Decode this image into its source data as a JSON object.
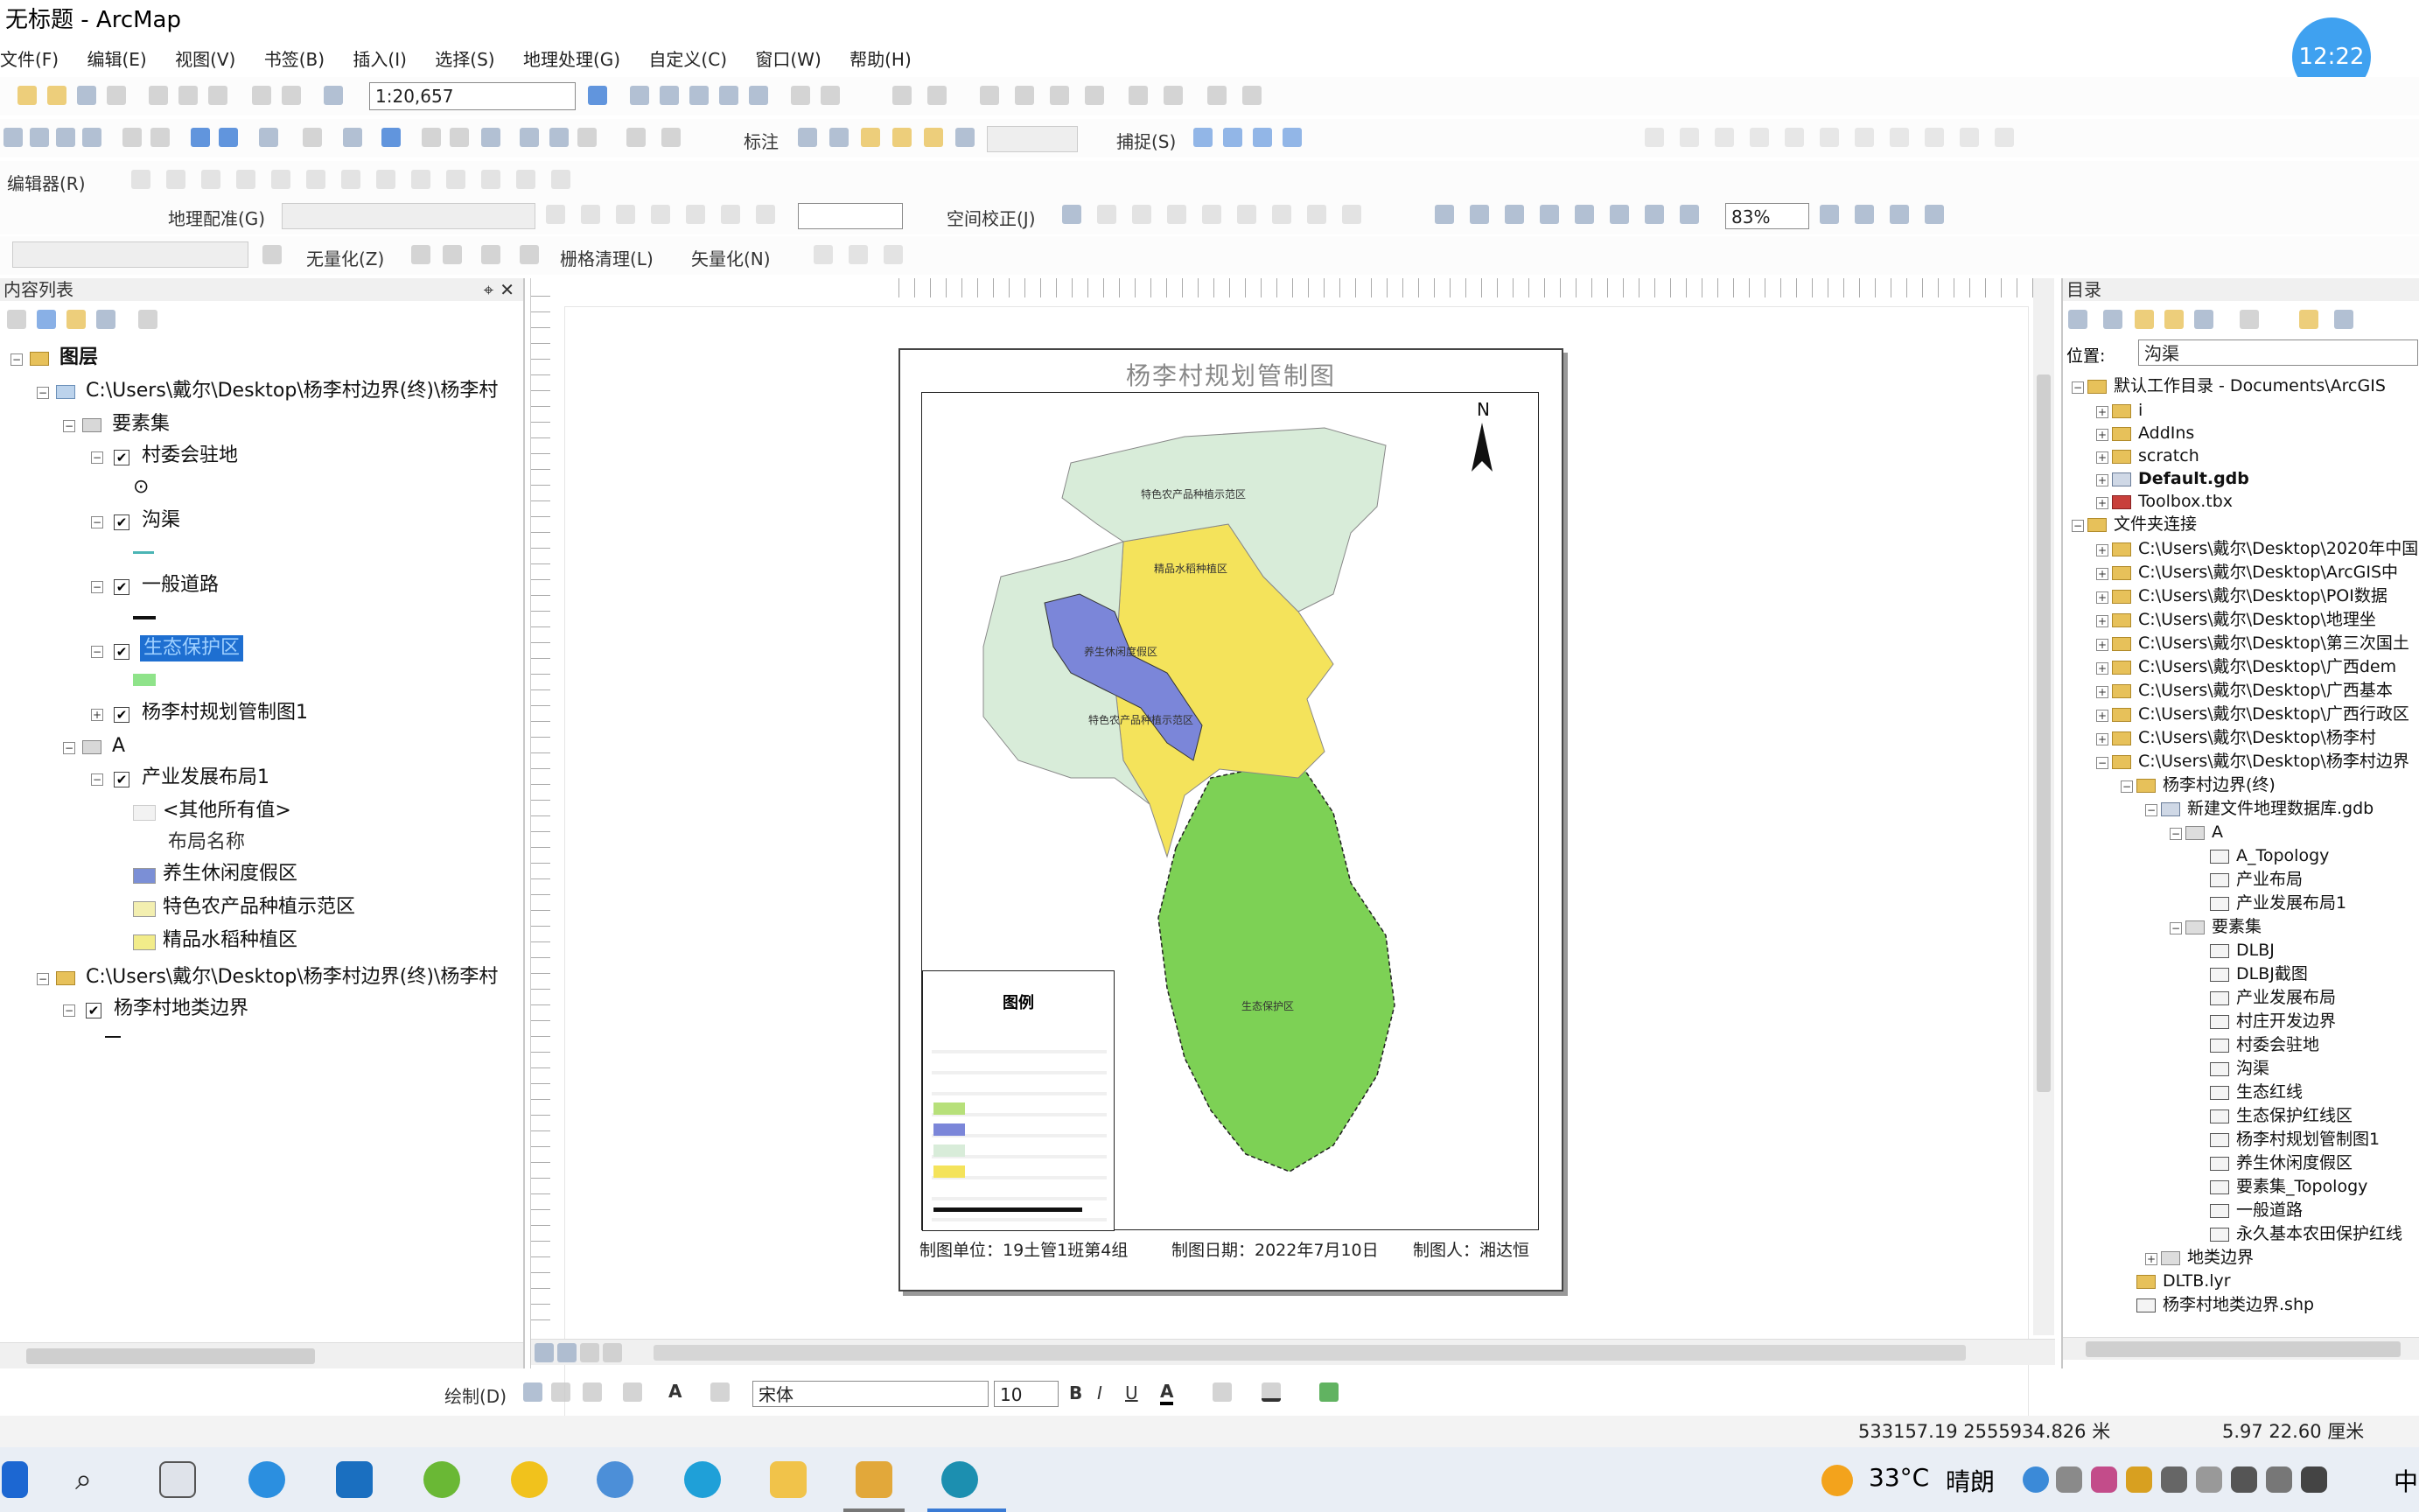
{
  "window": {
    "title": "无标题 - ArcMap"
  },
  "clock_badge": "12:22",
  "menu": [
    "文件(F)",
    "编辑(E)",
    "视图(V)",
    "书签(B)",
    "插入(I)",
    "选择(S)",
    "地理处理(G)",
    "自定义(C)",
    "窗口(W)",
    "帮助(H)"
  ],
  "toolbar": {
    "scale": "1:20,657",
    "label_tool": "标注",
    "snap_tool": "捕捉(S)",
    "editor_tool": "编辑器(R)",
    "georef_tool": "地理配准(G)",
    "spatial_adjust": "空间校正(J)",
    "zoom_percent": "83%",
    "symbol_tool": "无量化(Z)",
    "raster_clean": "栅格清理(L)",
    "vectorize": "矢量化(N)",
    "draw_label": "绘制(D)",
    "font_name": "宋体",
    "font_size": "10",
    "bold": "B",
    "italic": "I",
    "underline": "U"
  },
  "toc": {
    "title": "内容列表",
    "root": "图层",
    "path1": "C:\\Users\\戴尔\\Desktop\\杨李村边界(终)\\杨李村",
    "group_features": "要素集",
    "layer_village": "村委会驻地",
    "layer_ditch": "沟渠",
    "layer_road": "一般道路",
    "layer_selected": "生态保护区",
    "layer_plan": "杨李村规划管制图1",
    "group_a": "A",
    "layer_industry": "产业发展布局1",
    "legend_other": "<其他所有值>",
    "legend_field": "布局名称",
    "legend_items": [
      "养生休闲度假区",
      "特色农产品种植示范区",
      "精品水稻种植区"
    ],
    "legend_colors": [
      "#7b8fd6",
      "#f3efb0",
      "#f2ec8a"
    ],
    "path2": "C:\\Users\\戴尔\\Desktop\\杨李村边界(终)\\杨李村",
    "layer_boundary": "杨李村地类边界"
  },
  "map": {
    "title": "杨李村规划管制图",
    "north": "N",
    "legend_title": "图例",
    "zone_labels": [
      "特色农产品种植示范区",
      "精品水稻种植区",
      "养生休闲度假区",
      "特色农产品种植示范区",
      "生态保护区"
    ],
    "footer_unit": "制图单位：19土管1班第4组",
    "footer_date": "制图日期：2022年7月10日",
    "footer_author": "制图人：湘达恒",
    "colors": {
      "ecology": "#7ccf55",
      "farm": "#d7ecd9",
      "rice": "#f4e35a",
      "resort": "#7b86d9"
    }
  },
  "catalog": {
    "title": "目录",
    "location_label": "位置:",
    "location_value": "沟渠",
    "items": [
      "默认工作目录 - Documents\\ArcGIS",
      "i",
      "AddIns",
      "scratch",
      "Default.gdb",
      "Toolbox.tbx",
      "文件夹连接",
      "C:\\Users\\戴尔\\Desktop\\2020年中国",
      "C:\\Users\\戴尔\\Desktop\\ArcGIS中",
      "C:\\Users\\戴尔\\Desktop\\POI数据",
      "C:\\Users\\戴尔\\Desktop\\地理坐",
      "C:\\Users\\戴尔\\Desktop\\第三次国土",
      "C:\\Users\\戴尔\\Desktop\\广西dem",
      "C:\\Users\\戴尔\\Desktop\\广西基本",
      "C:\\Users\\戴尔\\Desktop\\广西行政区",
      "C:\\Users\\戴尔\\Desktop\\杨李村",
      "C:\\Users\\戴尔\\Desktop\\杨李村边界",
      "杨李村边界(终)",
      "新建文件地理数据库.gdb",
      "A",
      "A_Topology",
      "产业布局",
      "产业发展布局1",
      "要素集",
      "DLBJ",
      "DLBJ截图",
      "产业发展布局",
      "村庄开发边界",
      "村委会驻地",
      "沟渠",
      "生态红线",
      "生态保护红线区",
      "杨李村规划管制图1",
      "养生休闲度假区",
      "要素集_Topology",
      "一般道路",
      "永久基本农田保护红线",
      "地类边界",
      "DLTB.lyr",
      "杨李村地类边界.shp"
    ]
  },
  "status": {
    "coords": "533157.19  2555934.826 米",
    "page_coords": "5.97  22.60 厘米"
  },
  "taskbar": {
    "temperature": "33°C",
    "weather": "晴朗",
    "ime": "中"
  }
}
